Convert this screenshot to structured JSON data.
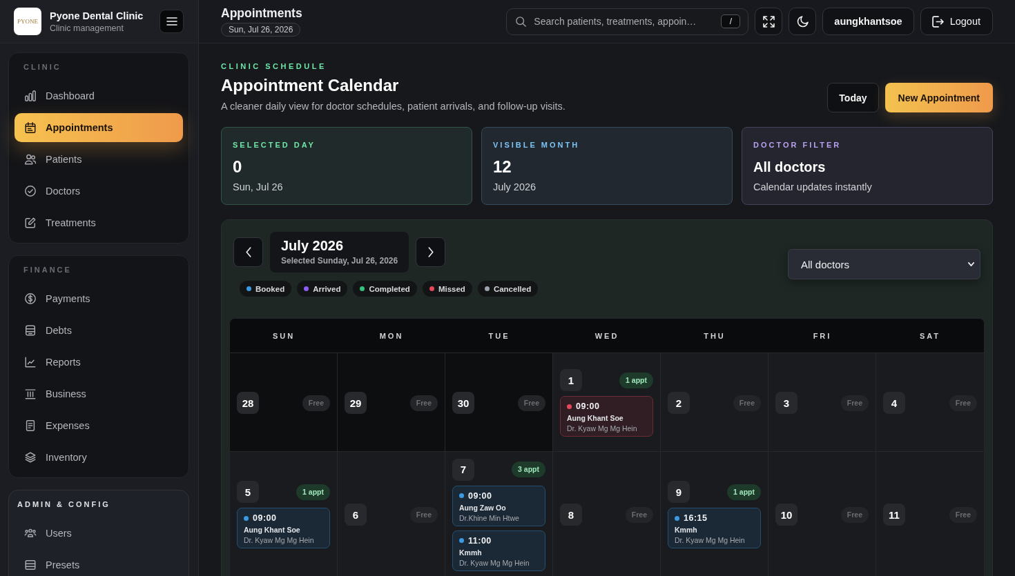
{
  "sidebar": {
    "brand": {
      "logo_text": "PYONE",
      "name": "Pyone Dental Clinic",
      "subtitle": "Clinic management"
    },
    "groups": [
      {
        "label": "CLINIC",
        "highlighted": false,
        "items": [
          {
            "label": "Dashboard",
            "selected": false
          },
          {
            "label": "Appointments",
            "selected": true
          },
          {
            "label": "Patients",
            "selected": false
          },
          {
            "label": "Doctors",
            "selected": false
          },
          {
            "label": "Treatments",
            "selected": false
          }
        ]
      },
      {
        "label": "FINANCE",
        "highlighted": false,
        "items": [
          {
            "label": "Payments",
            "selected": false
          },
          {
            "label": "Debts",
            "selected": false
          },
          {
            "label": "Reports",
            "selected": false
          },
          {
            "label": "Business",
            "selected": false
          },
          {
            "label": "Expenses",
            "selected": false
          },
          {
            "label": "Inventory",
            "selected": false
          }
        ]
      },
      {
        "label": "ADMIN & CONFIG",
        "highlighted": true,
        "items": [
          {
            "label": "Users",
            "selected": false
          },
          {
            "label": "Presets",
            "selected": false
          }
        ]
      }
    ]
  },
  "topbar": {
    "title": "Appointments",
    "date": "Sun, Jul 26, 2026",
    "search": {
      "placeholder": "Search patients, treatments, appoin…",
      "shortcut": "/"
    },
    "user": "aungkhantsoe",
    "logout": "Logout"
  },
  "page": {
    "eyebrow": "CLINIC SCHEDULE",
    "title": "Appointment Calendar",
    "subtitle": "A cleaner daily view for doctor schedules, patient arrivals, and follow-up visits.",
    "buttons": [
      {
        "label": "Today",
        "kind": "secondary"
      },
      {
        "label": "New Appointment",
        "kind": "primary"
      }
    ]
  },
  "stats": [
    {
      "label": "SELECTED DAY",
      "value": "0",
      "kind": "number",
      "note": "Sun, Jul 26",
      "color": "#6ee7a8"
    },
    {
      "label": "VISIBLE MONTH",
      "value": "12",
      "kind": "number",
      "note": "July 2026",
      "color": "#7cc4f5"
    },
    {
      "label": "DOCTOR FILTER",
      "value": "All doctors",
      "kind": "text",
      "note": "Calendar updates instantly",
      "color": "#b9a2f0"
    }
  ],
  "calendar": {
    "month": "July 2026",
    "selected_label": "Selected Sunday, Jul 26, 2026",
    "legend": [
      {
        "label": "Booked",
        "color": "#3b9ae1"
      },
      {
        "label": "Arrived",
        "color": "#8b5cf6"
      },
      {
        "label": "Completed",
        "color": "#34c27c"
      },
      {
        "label": "Missed",
        "color": "#e5485a"
      },
      {
        "label": "Cancelled",
        "color": "#9ca3af"
      }
    ],
    "doctor_filter": {
      "value": "All doctors"
    },
    "weekdays": [
      "SUN",
      "MON",
      "TUE",
      "WED",
      "THU",
      "FRI",
      "SAT"
    ],
    "weeks": [
      {
        "days": [
          {
            "date": "28",
            "outside_month": true,
            "free": true,
            "tag": "Free"
          },
          {
            "date": "29",
            "outside_month": true,
            "free": true,
            "tag": "Free"
          },
          {
            "date": "30",
            "outside_month": true,
            "free": true,
            "tag": "Free"
          },
          {
            "date": "1",
            "outside_month": false,
            "free": false,
            "tag": "1 appt",
            "appointments": [
              {
                "time": "09:00",
                "patient": "Aung Khant Soe",
                "doctor": "Dr. Kyaw Mg Mg Hein",
                "color": "#e5485a"
              }
            ]
          },
          {
            "date": "2",
            "outside_month": false,
            "free": true,
            "tag": "Free"
          },
          {
            "date": "3",
            "outside_month": false,
            "free": true,
            "tag": "Free"
          },
          {
            "date": "4",
            "outside_month": false,
            "free": true,
            "tag": "Free"
          }
        ]
      },
      {
        "days": [
          {
            "date": "5",
            "outside_month": false,
            "free": false,
            "tag": "1 appt",
            "appointments": [
              {
                "time": "09:00",
                "patient": "Aung Khant Soe",
                "doctor": "Dr. Kyaw Mg Mg Hein",
                "color": "#3b9ae1"
              }
            ]
          },
          {
            "date": "6",
            "outside_month": false,
            "free": true,
            "tag": "Free"
          },
          {
            "date": "7",
            "outside_month": false,
            "free": false,
            "tag": "3 appt",
            "appointments": [
              {
                "time": "09:00",
                "patient": "Aung Zaw Oo",
                "doctor": "Dr.Khine Min Htwe",
                "color": "#3b9ae1"
              },
              {
                "time": "11:00",
                "patient": "Kmmh",
                "doctor": "Dr. Kyaw Mg Mg Hein",
                "color": "#3b9ae1"
              }
            ]
          },
          {
            "date": "8",
            "outside_month": false,
            "free": true,
            "tag": "Free"
          },
          {
            "date": "9",
            "outside_month": false,
            "free": false,
            "tag": "1 appt",
            "appointments": [
              {
                "time": "16:15",
                "patient": "Kmmh",
                "doctor": "Dr. Kyaw Mg Mg Hein",
                "color": "#3b9ae1"
              }
            ]
          },
          {
            "date": "10",
            "outside_month": false,
            "free": true,
            "tag": "Free"
          },
          {
            "date": "11",
            "outside_month": false,
            "free": true,
            "tag": "Free"
          }
        ]
      }
    ]
  }
}
